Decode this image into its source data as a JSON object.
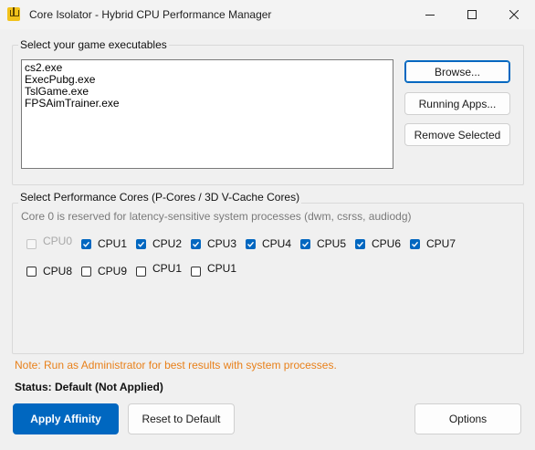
{
  "window": {
    "title": "Core Isolator - Hybrid CPU Performance Manager",
    "controls": {
      "minimize": "minimize-icon",
      "maximize": "maximize-icon",
      "close": "close-icon"
    }
  },
  "executables": {
    "group_title": "Select your game executables",
    "items": [
      "cs2.exe",
      "ExecPubg.exe",
      "TslGame.exe",
      "FPSAimTrainer.exe"
    ],
    "browse_label": "Browse...",
    "running_apps_label": "Running Apps...",
    "remove_label": "Remove Selected"
  },
  "cores": {
    "group_title": "Select Performance Cores (P-Cores / 3D V-Cache Cores)",
    "hint": "Core 0 is reserved for latency-sensitive system processes (dwm, csrss, audiodg)",
    "row1": [
      {
        "label": "CPU0",
        "checked": false,
        "disabled": true
      },
      {
        "label": "CPU1",
        "checked": true,
        "disabled": false
      },
      {
        "label": "CPU2",
        "checked": true,
        "disabled": false
      },
      {
        "label": "CPU3",
        "checked": true,
        "disabled": false
      },
      {
        "label": "CPU4",
        "checked": true,
        "disabled": false
      },
      {
        "label": "CPU5",
        "checked": true,
        "disabled": false
      },
      {
        "label": "CPU6",
        "checked": true,
        "disabled": false
      },
      {
        "label": "CPU7",
        "checked": true,
        "disabled": false
      }
    ],
    "row2": [
      {
        "label": "CPU8",
        "checked": false,
        "disabled": false
      },
      {
        "label": "CPU9",
        "checked": false,
        "disabled": false
      },
      {
        "label": "CPU1",
        "checked": false,
        "disabled": false
      },
      {
        "label": "CPU1",
        "checked": false,
        "disabled": false
      }
    ]
  },
  "note": "Note: Run as Administrator for best results with system processes.",
  "status": "Status: Default (Not Applied)",
  "buttons": {
    "apply": "Apply Affinity",
    "reset": "Reset to Default",
    "options": "Options"
  },
  "colors": {
    "accent": "#0067c0",
    "note": "#e8801a",
    "hint": "#7a7a7a"
  }
}
